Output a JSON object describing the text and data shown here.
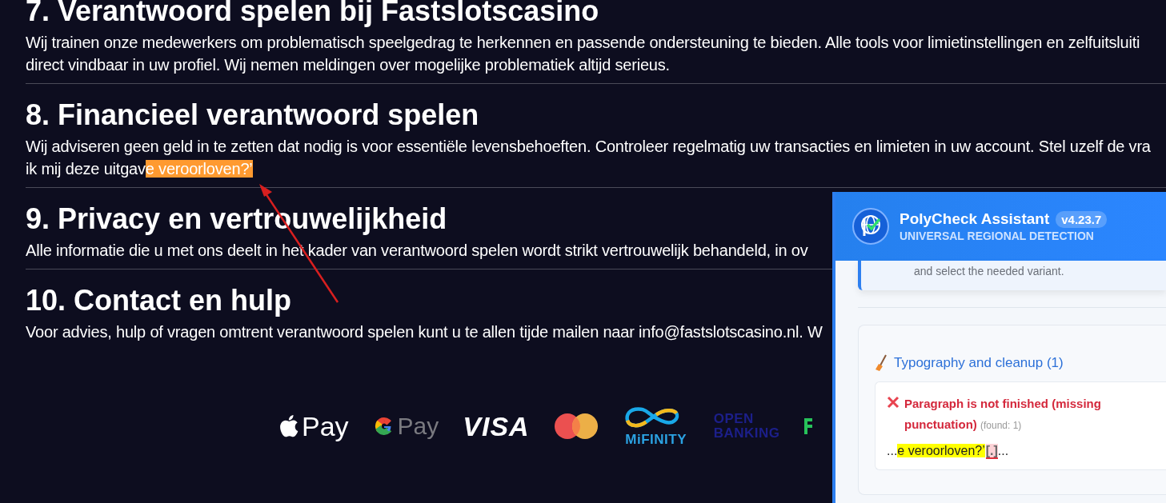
{
  "sections": [
    {
      "title": "7. Verantwoord spelen bij Fastslotscasino",
      "lines": [
        {
          "text": "Wij trainen onze medewerkers om problematisch speelgedrag te herkennen en passende ondersteuning te bieden. Alle tools voor limietinstellingen en zelfuitsluiti"
        },
        {
          "text": "direct vindbaar in uw profiel. Wij nemen meldingen over mogelijke problematiek altijd serieus."
        }
      ]
    },
    {
      "title": "8. Financieel verantwoord spelen",
      "lines": [
        {
          "text": "Wij adviseren geen geld in te zetten dat nodig is voor essentiële levensbehoeften. Controleer regelmatig uw transacties en limieten in uw account. Stel uzelf de vra"
        },
        {
          "text": "ik mij deze uitgav",
          "highlight": "e veroorloven?’"
        }
      ]
    },
    {
      "title": "9. Privacy en vertrouwelijkheid",
      "lines": [
        {
          "text": "Alle informatie die u met ons deelt in het kader van verantwoord spelen wordt strikt vertrouwelijk behandeld, in ov"
        }
      ]
    },
    {
      "title": "10. Contact en hulp",
      "lines": [
        {
          "text": "Voor advies, hulp of vragen omtrent verantwoord spelen kunt u te allen tijde mailen naar info@fastslotscasino.nl. W"
        }
      ]
    }
  ],
  "payment_logos": [
    {
      "kind": "apple-pay",
      "label": "Pay"
    },
    {
      "kind": "google-pay",
      "label": "Pay"
    },
    {
      "kind": "visa",
      "label": "VISA"
    },
    {
      "kind": "mastercard"
    },
    {
      "kind": "mifinity",
      "label": "MiFINITY"
    },
    {
      "kind": "open-banking",
      "lines": [
        "OPEN",
        "BANKING"
      ]
    },
    {
      "kind": "partial"
    }
  ],
  "panel": {
    "title": "PolyCheck Assistant",
    "version": "v4.23.7",
    "subtitle": "UNIVERSAL REGIONAL DETECTION",
    "notice": "and select the needed variant.",
    "group": {
      "title": "Typography and cleanup (1)",
      "issues": [
        {
          "title": "Paragraph is not finished (missing punctuation)",
          "count": "(found: 1)",
          "snippet": {
            "before": "...",
            "match": "e veroorloven?’",
            "suggestion": "[.]",
            "after": "..."
          }
        }
      ]
    }
  }
}
